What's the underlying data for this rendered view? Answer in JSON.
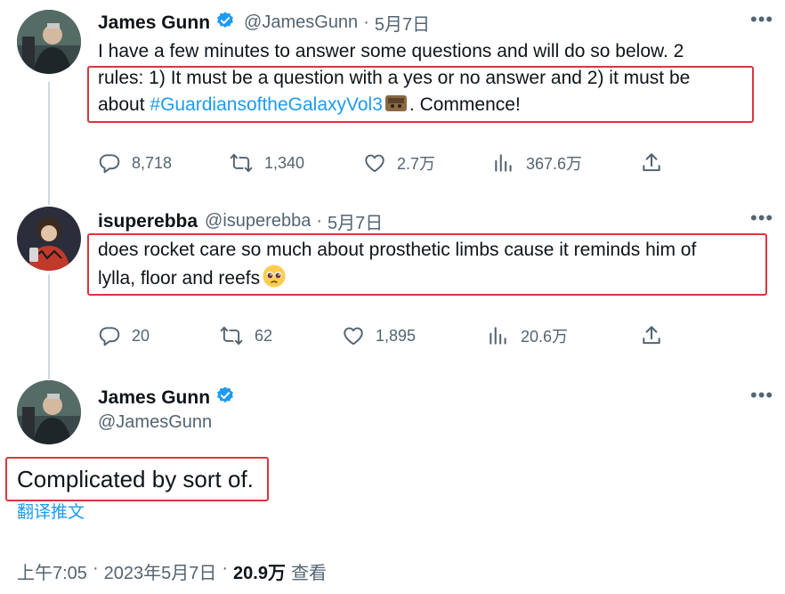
{
  "tweet1": {
    "name": "James Gunn",
    "handle": "@JamesGunn",
    "sep": "·",
    "date": "5月7日",
    "line1": "I have a few minutes to answer some questions and will do so below. 2",
    "line2": "rules: 1) It must be a question with a yes or no answer and 2) it must be",
    "line3_prefix": "about ",
    "hashtag": "#GuardiansoftheGalaxyVol3",
    "line3_suffix": ". Commence!",
    "stats": {
      "replies": "8,718",
      "retweets": "1,340",
      "likes": "2.7万",
      "views": "367.6万"
    }
  },
  "tweet2": {
    "name": "isuperebba",
    "handle": "@isuperebba",
    "sep": "·",
    "date": "5月7日",
    "line1": "does rocket care so much about prosthetic limbs cause it reminds him of",
    "line2": "lylla, floor and reefs",
    "stats": {
      "replies": "20",
      "retweets": "62",
      "likes": "1,895",
      "views": "20.6万"
    }
  },
  "tweet3": {
    "name": "James Gunn",
    "handle": "@JamesGunn",
    "text": "Complicated by sort of.",
    "translate": "翻译推文",
    "time": "上午7:05",
    "sep1": "·",
    "date": "2023年5月7日",
    "sep2": "·",
    "views_count": "20.9万",
    "views_label": "查看"
  },
  "colors": {
    "accent": "#1d9bf0",
    "highlight_box": "#d9363e",
    "secondary_text": "#536471"
  },
  "icons": [
    "verified-badge-icon",
    "more-icon",
    "reply-icon",
    "retweet-icon",
    "like-icon",
    "views-icon",
    "share-icon"
  ]
}
